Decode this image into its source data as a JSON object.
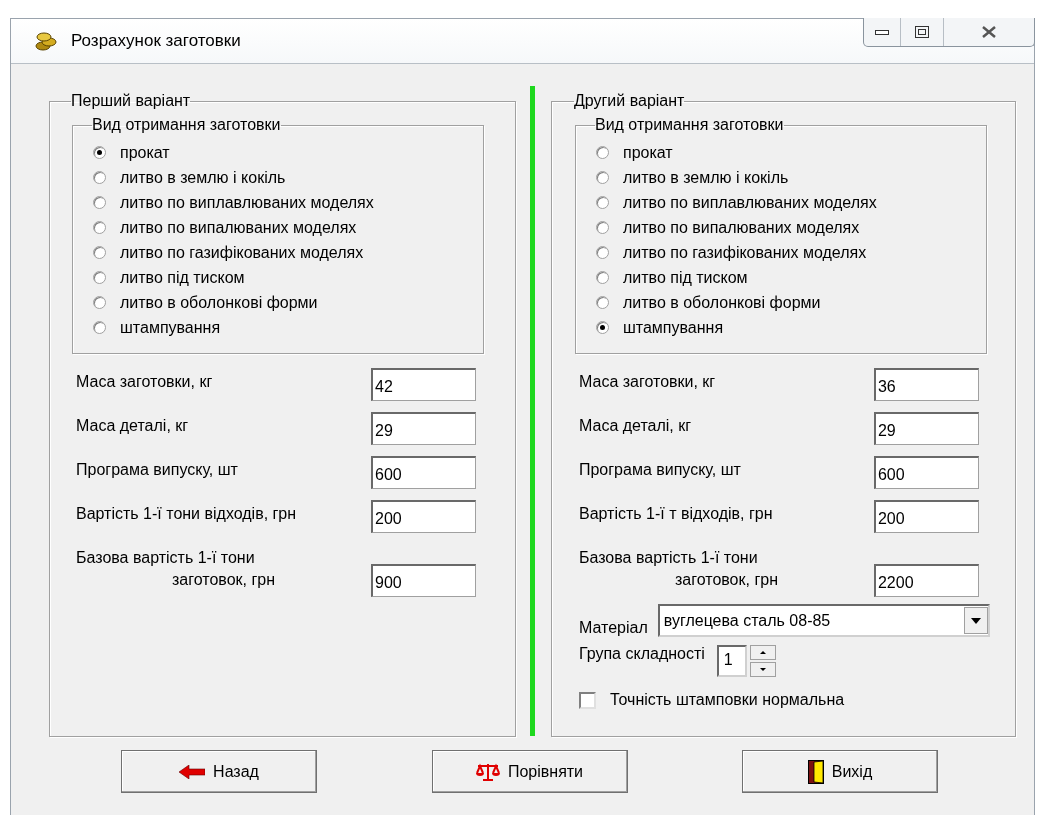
{
  "window": {
    "title": "Розрахунок заготовки"
  },
  "variants": [
    {
      "title": "Перший варіант",
      "method_group": {
        "title": "Вид отримання заготовки",
        "options": [
          {
            "label": "прокат",
            "selected": true
          },
          {
            "label": "литво в землю і кокіль",
            "selected": false
          },
          {
            "label": "литво по виплавлюваних моделях",
            "selected": false
          },
          {
            "label": "литво по випалюваних моделях",
            "selected": false
          },
          {
            "label": "литво по газифікованих моделях",
            "selected": false
          },
          {
            "label": "литво під тиском",
            "selected": false
          },
          {
            "label": "литво в оболонкові форми",
            "selected": false
          },
          {
            "label": "штампування",
            "selected": false
          }
        ]
      },
      "fields": [
        {
          "kind": "single",
          "label": "Маса заготовки, кг",
          "value": "42"
        },
        {
          "kind": "single",
          "label": "Маса деталі, кг",
          "value": "29"
        },
        {
          "kind": "single",
          "label": "Програма випуску, шт",
          "value": "600"
        },
        {
          "kind": "single",
          "label": "Вартість 1-ї тони відходів, грн",
          "value": "200"
        },
        {
          "kind": "double",
          "label": "Базова вартість 1-ї тони",
          "label_2": "заготовок, грн",
          "value": "900"
        }
      ]
    },
    {
      "title": "Другий  варіант",
      "method_group": {
        "title": "Вид отримання заготовки",
        "options": [
          {
            "label": "прокат",
            "selected": false
          },
          {
            "label": "литво в землю і кокіль",
            "selected": false
          },
          {
            "label": "литво по виплавлюваних моделях",
            "selected": false
          },
          {
            "label": "литво по випалюваних моделях",
            "selected": false
          },
          {
            "label": "литво по газифікованих моделях",
            "selected": false
          },
          {
            "label": "литво під тиском",
            "selected": false
          },
          {
            "label": "литво в оболонкові форми",
            "selected": false
          },
          {
            "label": "штампування",
            "selected": true
          }
        ]
      },
      "fields": [
        {
          "kind": "single",
          "label": "Маса заготовки, кг",
          "value": "36"
        },
        {
          "kind": "single",
          "label": "Маса деталі, кг",
          "value": "29"
        },
        {
          "kind": "single",
          "label": "Програма випуску, шт",
          "value": "600"
        },
        {
          "kind": "single",
          "label": "Вартість 1-ї т відходів, грн",
          "value": "200"
        },
        {
          "kind": "double",
          "label": "Базова вартість 1-ї тони",
          "label_2": "заготовок, грн",
          "value": "2200"
        }
      ],
      "material": {
        "label": "Матеріал",
        "value": "вуглецева сталь 08-85"
      },
      "complexity": {
        "label": "Група складності",
        "value": "1"
      },
      "precision": {
        "label": "Точність штамповки нормальна",
        "checked": false
      }
    }
  ],
  "buttons": [
    {
      "label": "Назад",
      "kind": "back"
    },
    {
      "label": "Порівняти",
      "kind": "compare"
    },
    {
      "label": "Вихід",
      "kind": "exit"
    }
  ]
}
